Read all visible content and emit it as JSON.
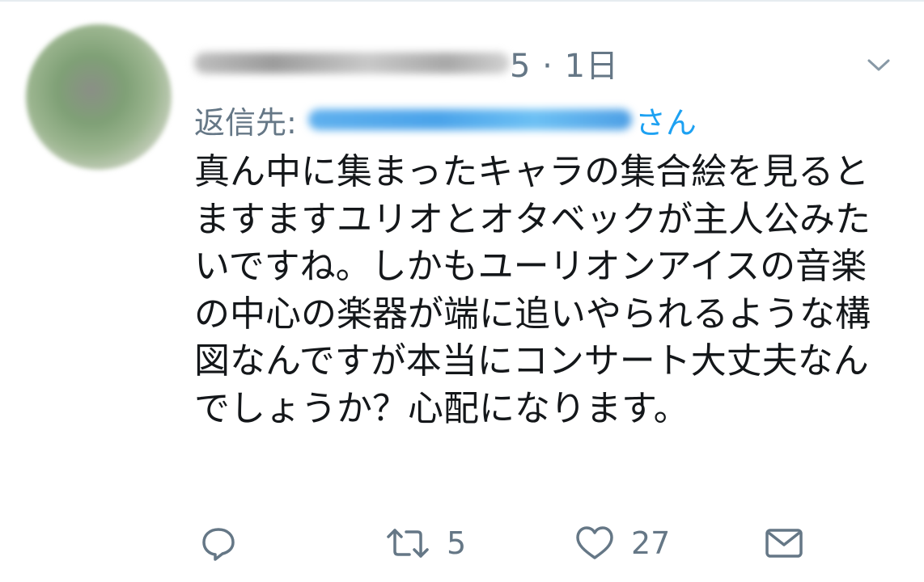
{
  "tweet": {
    "time": "5 · 1日",
    "reply_prefix": "返信先: ",
    "reply_suffix": "さん",
    "text": "真ん中に集まったキャラの集合絵を見るとますますユリオとオタベックが主人公みたいですね。しかもユーリオンアイスの音楽の中心の楽器が端に追いやられるような構図なんですが本当にコンサート大丈夫なんでしょうか？心配になります。"
  },
  "actions": {
    "retweet_count": "5",
    "like_count": "27"
  },
  "icons": {
    "more": "chevron-down-icon",
    "reply": "reply-icon",
    "retweet": "retweet-icon",
    "like": "heart-icon",
    "message": "envelope-icon"
  },
  "colors": {
    "text": "#14171a",
    "secondary": "#657786",
    "link": "#1da1f2"
  }
}
